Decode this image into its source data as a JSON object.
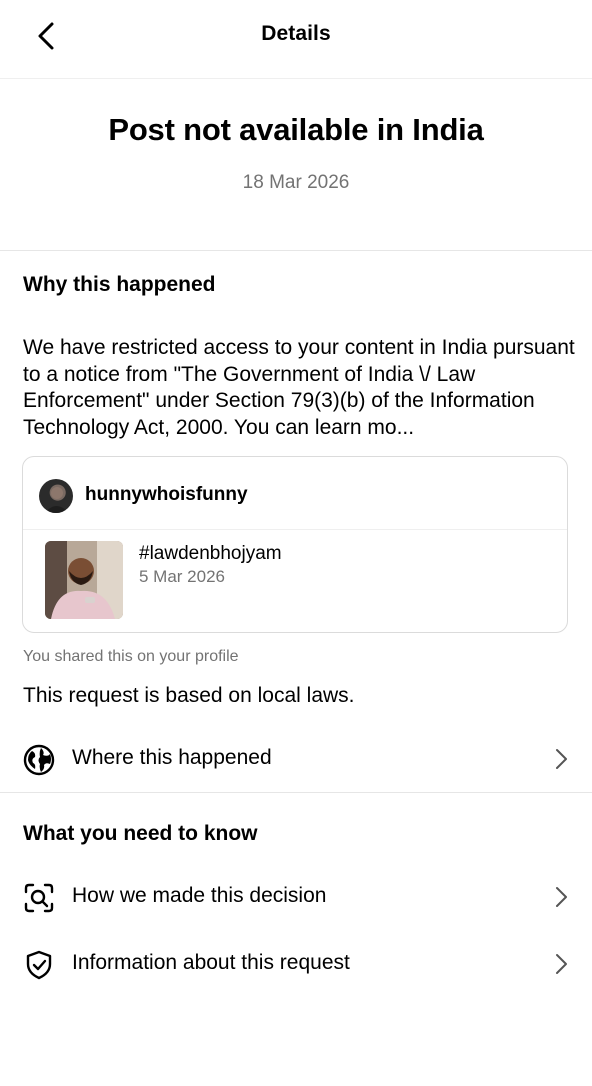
{
  "header": {
    "title": "Details",
    "back_icon": "chevron-left-icon"
  },
  "hero": {
    "title": "Post not available in India",
    "date": "18 Mar 2026"
  },
  "why": {
    "heading": "Why this happened",
    "body": "We have restricted access to your content in India pursuant to a notice from \"The Government of India \\/ Law Enforcement\" under Section 79(3)(b) of the Information Technology Act, 2000. You can learn mo..."
  },
  "post_card": {
    "username": "hunnywhoisfunny",
    "post_title": "#lawdenbhojyam",
    "post_date": "5 Mar 2026"
  },
  "shared_note": "You shared this on your profile",
  "local_laws": "This request is based on local laws.",
  "where_row": {
    "label": "Where this happened",
    "icon": "globe-icon"
  },
  "know": {
    "heading": "What you need to know",
    "items": [
      {
        "label": "How we made this decision",
        "icon": "search-scan-icon"
      },
      {
        "label": "Information about this request",
        "icon": "shield-check-icon"
      }
    ]
  },
  "colors": {
    "text": "#000000",
    "secondary": "#737373",
    "divider": "#e6e6e6",
    "card_border": "#dbdbdb"
  }
}
